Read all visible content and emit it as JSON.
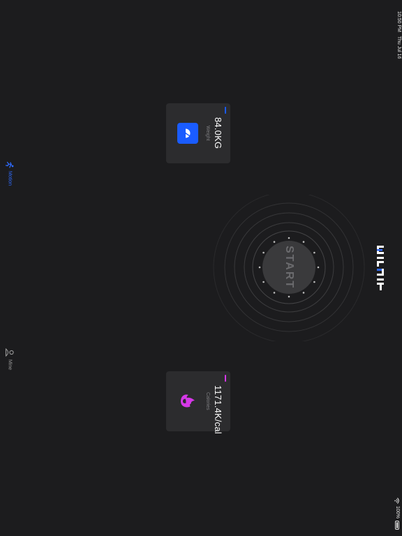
{
  "status_bar": {
    "time": "10:50 PM",
    "date": "Thu Jul 16",
    "battery": "100%",
    "wifi_icon": "wifi-icon"
  },
  "tab_bar": {
    "items": [
      {
        "label": "Motion",
        "icon": "running-person-icon",
        "active": true,
        "color": "#2f6bff"
      },
      {
        "label": "Mine",
        "icon": "person-icon",
        "active": false,
        "color": "#9a9a9a"
      }
    ]
  },
  "cards": {
    "weight": {
      "value": "84.0KG",
      "label": "Weight",
      "icon": "scale-gauge-icon",
      "accent": "#1a5cff"
    },
    "calories": {
      "value": "1171.4K/cal",
      "label": "Calories",
      "icon": "flame-icon",
      "accent": "#d638e8"
    }
  },
  "start": {
    "label": "START"
  },
  "logo": {
    "name": "brand-logo"
  }
}
